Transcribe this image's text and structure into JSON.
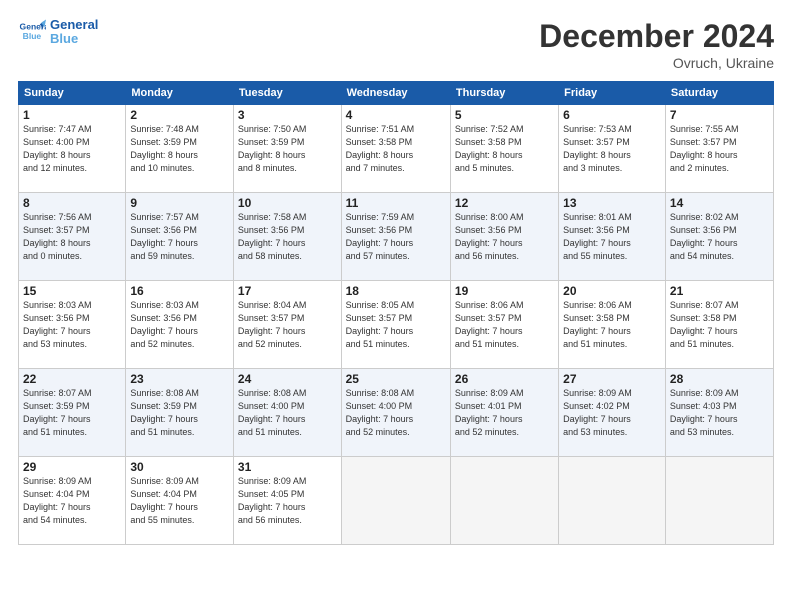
{
  "logo": {
    "line1": "General",
    "line2": "Blue"
  },
  "header": {
    "month": "December 2024",
    "location": "Ovruch, Ukraine"
  },
  "weekdays": [
    "Sunday",
    "Monday",
    "Tuesday",
    "Wednesday",
    "Thursday",
    "Friday",
    "Saturday"
  ],
  "weeks": [
    [
      {
        "day": "1",
        "detail": "Sunrise: 7:47 AM\nSunset: 4:00 PM\nDaylight: 8 hours\nand 12 minutes."
      },
      {
        "day": "2",
        "detail": "Sunrise: 7:48 AM\nSunset: 3:59 PM\nDaylight: 8 hours\nand 10 minutes."
      },
      {
        "day": "3",
        "detail": "Sunrise: 7:50 AM\nSunset: 3:59 PM\nDaylight: 8 hours\nand 8 minutes."
      },
      {
        "day": "4",
        "detail": "Sunrise: 7:51 AM\nSunset: 3:58 PM\nDaylight: 8 hours\nand 7 minutes."
      },
      {
        "day": "5",
        "detail": "Sunrise: 7:52 AM\nSunset: 3:58 PM\nDaylight: 8 hours\nand 5 minutes."
      },
      {
        "day": "6",
        "detail": "Sunrise: 7:53 AM\nSunset: 3:57 PM\nDaylight: 8 hours\nand 3 minutes."
      },
      {
        "day": "7",
        "detail": "Sunrise: 7:55 AM\nSunset: 3:57 PM\nDaylight: 8 hours\nand 2 minutes."
      }
    ],
    [
      {
        "day": "8",
        "detail": "Sunrise: 7:56 AM\nSunset: 3:57 PM\nDaylight: 8 hours\nand 0 minutes."
      },
      {
        "day": "9",
        "detail": "Sunrise: 7:57 AM\nSunset: 3:56 PM\nDaylight: 7 hours\nand 59 minutes."
      },
      {
        "day": "10",
        "detail": "Sunrise: 7:58 AM\nSunset: 3:56 PM\nDaylight: 7 hours\nand 58 minutes."
      },
      {
        "day": "11",
        "detail": "Sunrise: 7:59 AM\nSunset: 3:56 PM\nDaylight: 7 hours\nand 57 minutes."
      },
      {
        "day": "12",
        "detail": "Sunrise: 8:00 AM\nSunset: 3:56 PM\nDaylight: 7 hours\nand 56 minutes."
      },
      {
        "day": "13",
        "detail": "Sunrise: 8:01 AM\nSunset: 3:56 PM\nDaylight: 7 hours\nand 55 minutes."
      },
      {
        "day": "14",
        "detail": "Sunrise: 8:02 AM\nSunset: 3:56 PM\nDaylight: 7 hours\nand 54 minutes."
      }
    ],
    [
      {
        "day": "15",
        "detail": "Sunrise: 8:03 AM\nSunset: 3:56 PM\nDaylight: 7 hours\nand 53 minutes."
      },
      {
        "day": "16",
        "detail": "Sunrise: 8:03 AM\nSunset: 3:56 PM\nDaylight: 7 hours\nand 52 minutes."
      },
      {
        "day": "17",
        "detail": "Sunrise: 8:04 AM\nSunset: 3:57 PM\nDaylight: 7 hours\nand 52 minutes."
      },
      {
        "day": "18",
        "detail": "Sunrise: 8:05 AM\nSunset: 3:57 PM\nDaylight: 7 hours\nand 51 minutes."
      },
      {
        "day": "19",
        "detail": "Sunrise: 8:06 AM\nSunset: 3:57 PM\nDaylight: 7 hours\nand 51 minutes."
      },
      {
        "day": "20",
        "detail": "Sunrise: 8:06 AM\nSunset: 3:58 PM\nDaylight: 7 hours\nand 51 minutes."
      },
      {
        "day": "21",
        "detail": "Sunrise: 8:07 AM\nSunset: 3:58 PM\nDaylight: 7 hours\nand 51 minutes."
      }
    ],
    [
      {
        "day": "22",
        "detail": "Sunrise: 8:07 AM\nSunset: 3:59 PM\nDaylight: 7 hours\nand 51 minutes."
      },
      {
        "day": "23",
        "detail": "Sunrise: 8:08 AM\nSunset: 3:59 PM\nDaylight: 7 hours\nand 51 minutes."
      },
      {
        "day": "24",
        "detail": "Sunrise: 8:08 AM\nSunset: 4:00 PM\nDaylight: 7 hours\nand 51 minutes."
      },
      {
        "day": "25",
        "detail": "Sunrise: 8:08 AM\nSunset: 4:00 PM\nDaylight: 7 hours\nand 52 minutes."
      },
      {
        "day": "26",
        "detail": "Sunrise: 8:09 AM\nSunset: 4:01 PM\nDaylight: 7 hours\nand 52 minutes."
      },
      {
        "day": "27",
        "detail": "Sunrise: 8:09 AM\nSunset: 4:02 PM\nDaylight: 7 hours\nand 53 minutes."
      },
      {
        "day": "28",
        "detail": "Sunrise: 8:09 AM\nSunset: 4:03 PM\nDaylight: 7 hours\nand 53 minutes."
      }
    ],
    [
      {
        "day": "29",
        "detail": "Sunrise: 8:09 AM\nSunset: 4:04 PM\nDaylight: 7 hours\nand 54 minutes."
      },
      {
        "day": "30",
        "detail": "Sunrise: 8:09 AM\nSunset: 4:04 PM\nDaylight: 7 hours\nand 55 minutes."
      },
      {
        "day": "31",
        "detail": "Sunrise: 8:09 AM\nSunset: 4:05 PM\nDaylight: 7 hours\nand 56 minutes."
      },
      null,
      null,
      null,
      null
    ]
  ]
}
